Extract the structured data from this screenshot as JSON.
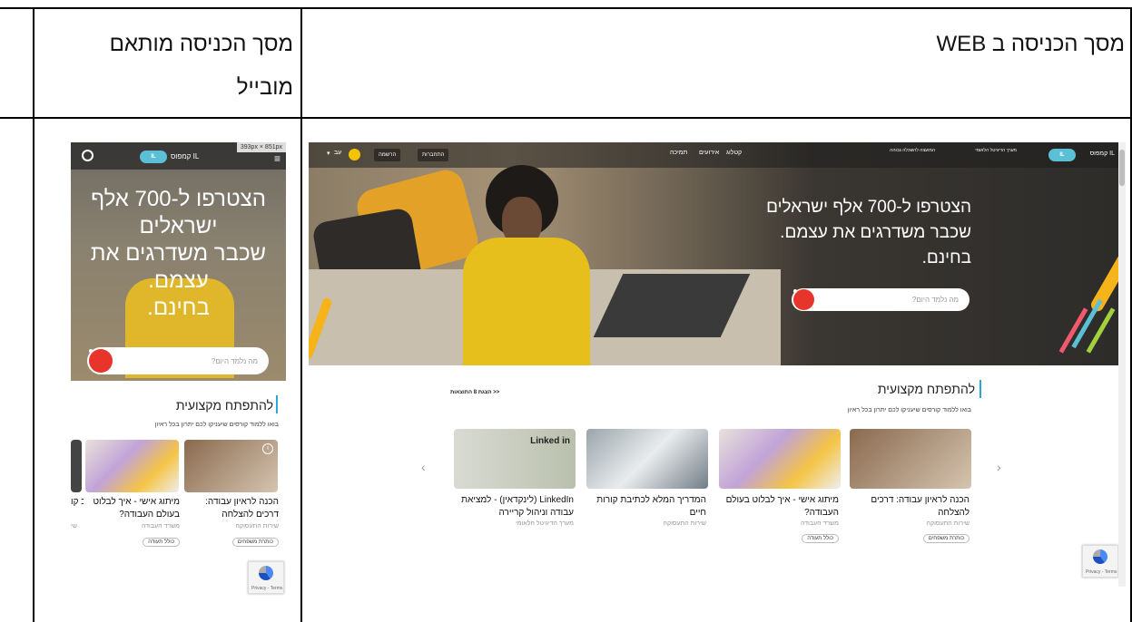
{
  "table": {
    "header_web": "מסך הכניסה ב WEB",
    "header_mobile_line1": "מסך הכניסה מותאם",
    "header_mobile_line2": "מובייל"
  },
  "desktop": {
    "nav": {
      "links": [
        "קטלוג",
        "אירועים",
        "תמיכה"
      ],
      "login": "התחברות",
      "register": "הרשמה",
      "language": "עב",
      "logo_text": "קמפוס IL",
      "gov_text_1": "מערך הדיגיטל הלאומי",
      "gov_text_2": "המועצה להשכלה גבוהה"
    },
    "hero": {
      "line1": "הצטרפו ל-700 אלף ישראלים",
      "line2": "שכבר משדרגים את עצמם.",
      "line3": "בחינם.",
      "search_placeholder": "מה נלמד היום?"
    },
    "section": {
      "title": "להתפתח מקצועית",
      "subtitle": "בואו ללמוד קורסים שיעניקו לכם יתרון בכל ראיון",
      "show_all": "הצגת 8 התוצאות >>"
    },
    "cards": [
      {
        "title": "הכנה לראיון עבודה: דרכים להצלחה",
        "org": "שירות התעסוקה",
        "tag": "כותרת משפחים"
      },
      {
        "title": "מיתוג אישי - איך לבלוט בעולם העבודה?",
        "org": "משרד העבודה",
        "tag": "כולל תעודה"
      },
      {
        "title": "המדריך המלא לכתיבת קורות חיים",
        "org": "שירות התעסוקה",
        "tag": ""
      },
      {
        "title": "LinkedIn (לינקדאין) - למציאת עבודה וניהול קריירה",
        "org": "מערך הדיגיטל הלאומי",
        "tag": ""
      }
    ],
    "recaptcha": "Privacy - Terms",
    "card_image_brand": "Linked in"
  },
  "mobile": {
    "dimensions": "393px × 851px",
    "hero": {
      "line1": "הצטרפו ל-700 אלף",
      "line2": "ישראלים",
      "line3": "שכבר משדרגים את",
      "line4": "עצמם.",
      "line5": "בחינם.",
      "search_placeholder": "מה נלמד היום?"
    },
    "section": {
      "title": "להתפתח מקצועית",
      "subtitle": "בואו ללמוד קורסים שיעניקו לכם יתרון בכל ראיון"
    },
    "cards": [
      {
        "title": "הכנה לראיון עבודה: דרכים להצלחה",
        "org": "שירות התעסוקה",
        "tag": "כותרת משפחים"
      },
      {
        "title": "מיתוג אישי - איך לבלוט בעולם העבודה?",
        "org": "משרד העבודה",
        "tag": "כולל תעודה"
      },
      {
        "title": "הכ קו",
        "org": "שי",
        "tag": ""
      }
    ],
    "recaptcha": "Privacy - Terms"
  },
  "colors": {
    "accent": "#2aa7d8",
    "search_button": "#e8352c",
    "logo": "#5bc0d6",
    "globe": "#f5c400"
  }
}
